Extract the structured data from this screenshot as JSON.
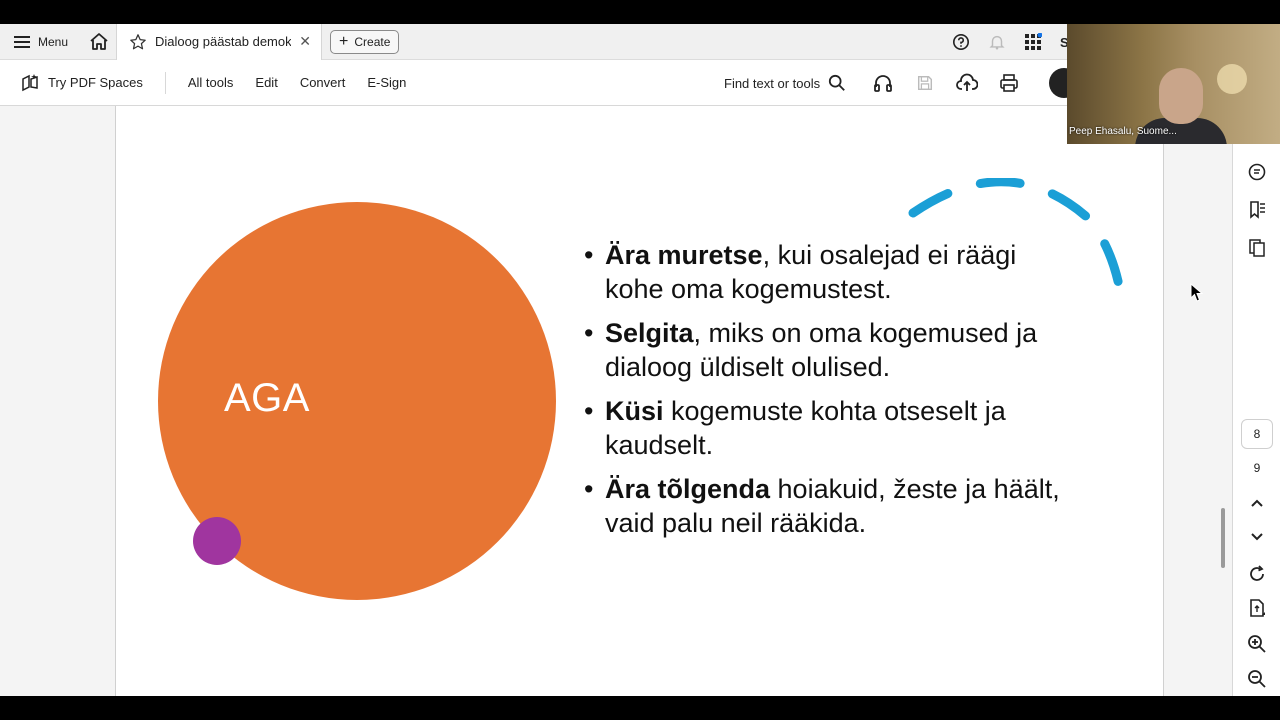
{
  "tabbar": {
    "menu_label": "Menu",
    "tab_title": "Dialoog päästab demok...",
    "create_label": "Create",
    "truncated_letter": "S"
  },
  "toolbar": {
    "pdf_spaces": "Try PDF Spaces",
    "all_tools": "All tools",
    "edit": "Edit",
    "convert": "Convert",
    "esign": "E-Sign",
    "find": "Find text or tools"
  },
  "slide": {
    "circle_label": "AGA",
    "bullets": [
      {
        "bold": "Ära muretse",
        "rest": ", kui osalejad ei räägi kohe oma kogemustest."
      },
      {
        "bold": "Selgita",
        "rest": ", miks on oma kogemused ja dialoog üldiselt olulised."
      },
      {
        "bold": "Küsi",
        "rest": " kogemuste kohta otseselt ja kaudselt."
      },
      {
        "bold": "Ära tõlgenda",
        "rest": " hoiakuid, žeste ja häält, vaid palu neil rääkida."
      }
    ],
    "colors": {
      "big_circle": "#e77533",
      "small_circle": "#a0359f",
      "arc": "#1b9fd6"
    }
  },
  "rail": {
    "current_page": "8",
    "next_page": "9"
  },
  "video": {
    "participant_name": "Peep Ehasalu, Suome..."
  }
}
